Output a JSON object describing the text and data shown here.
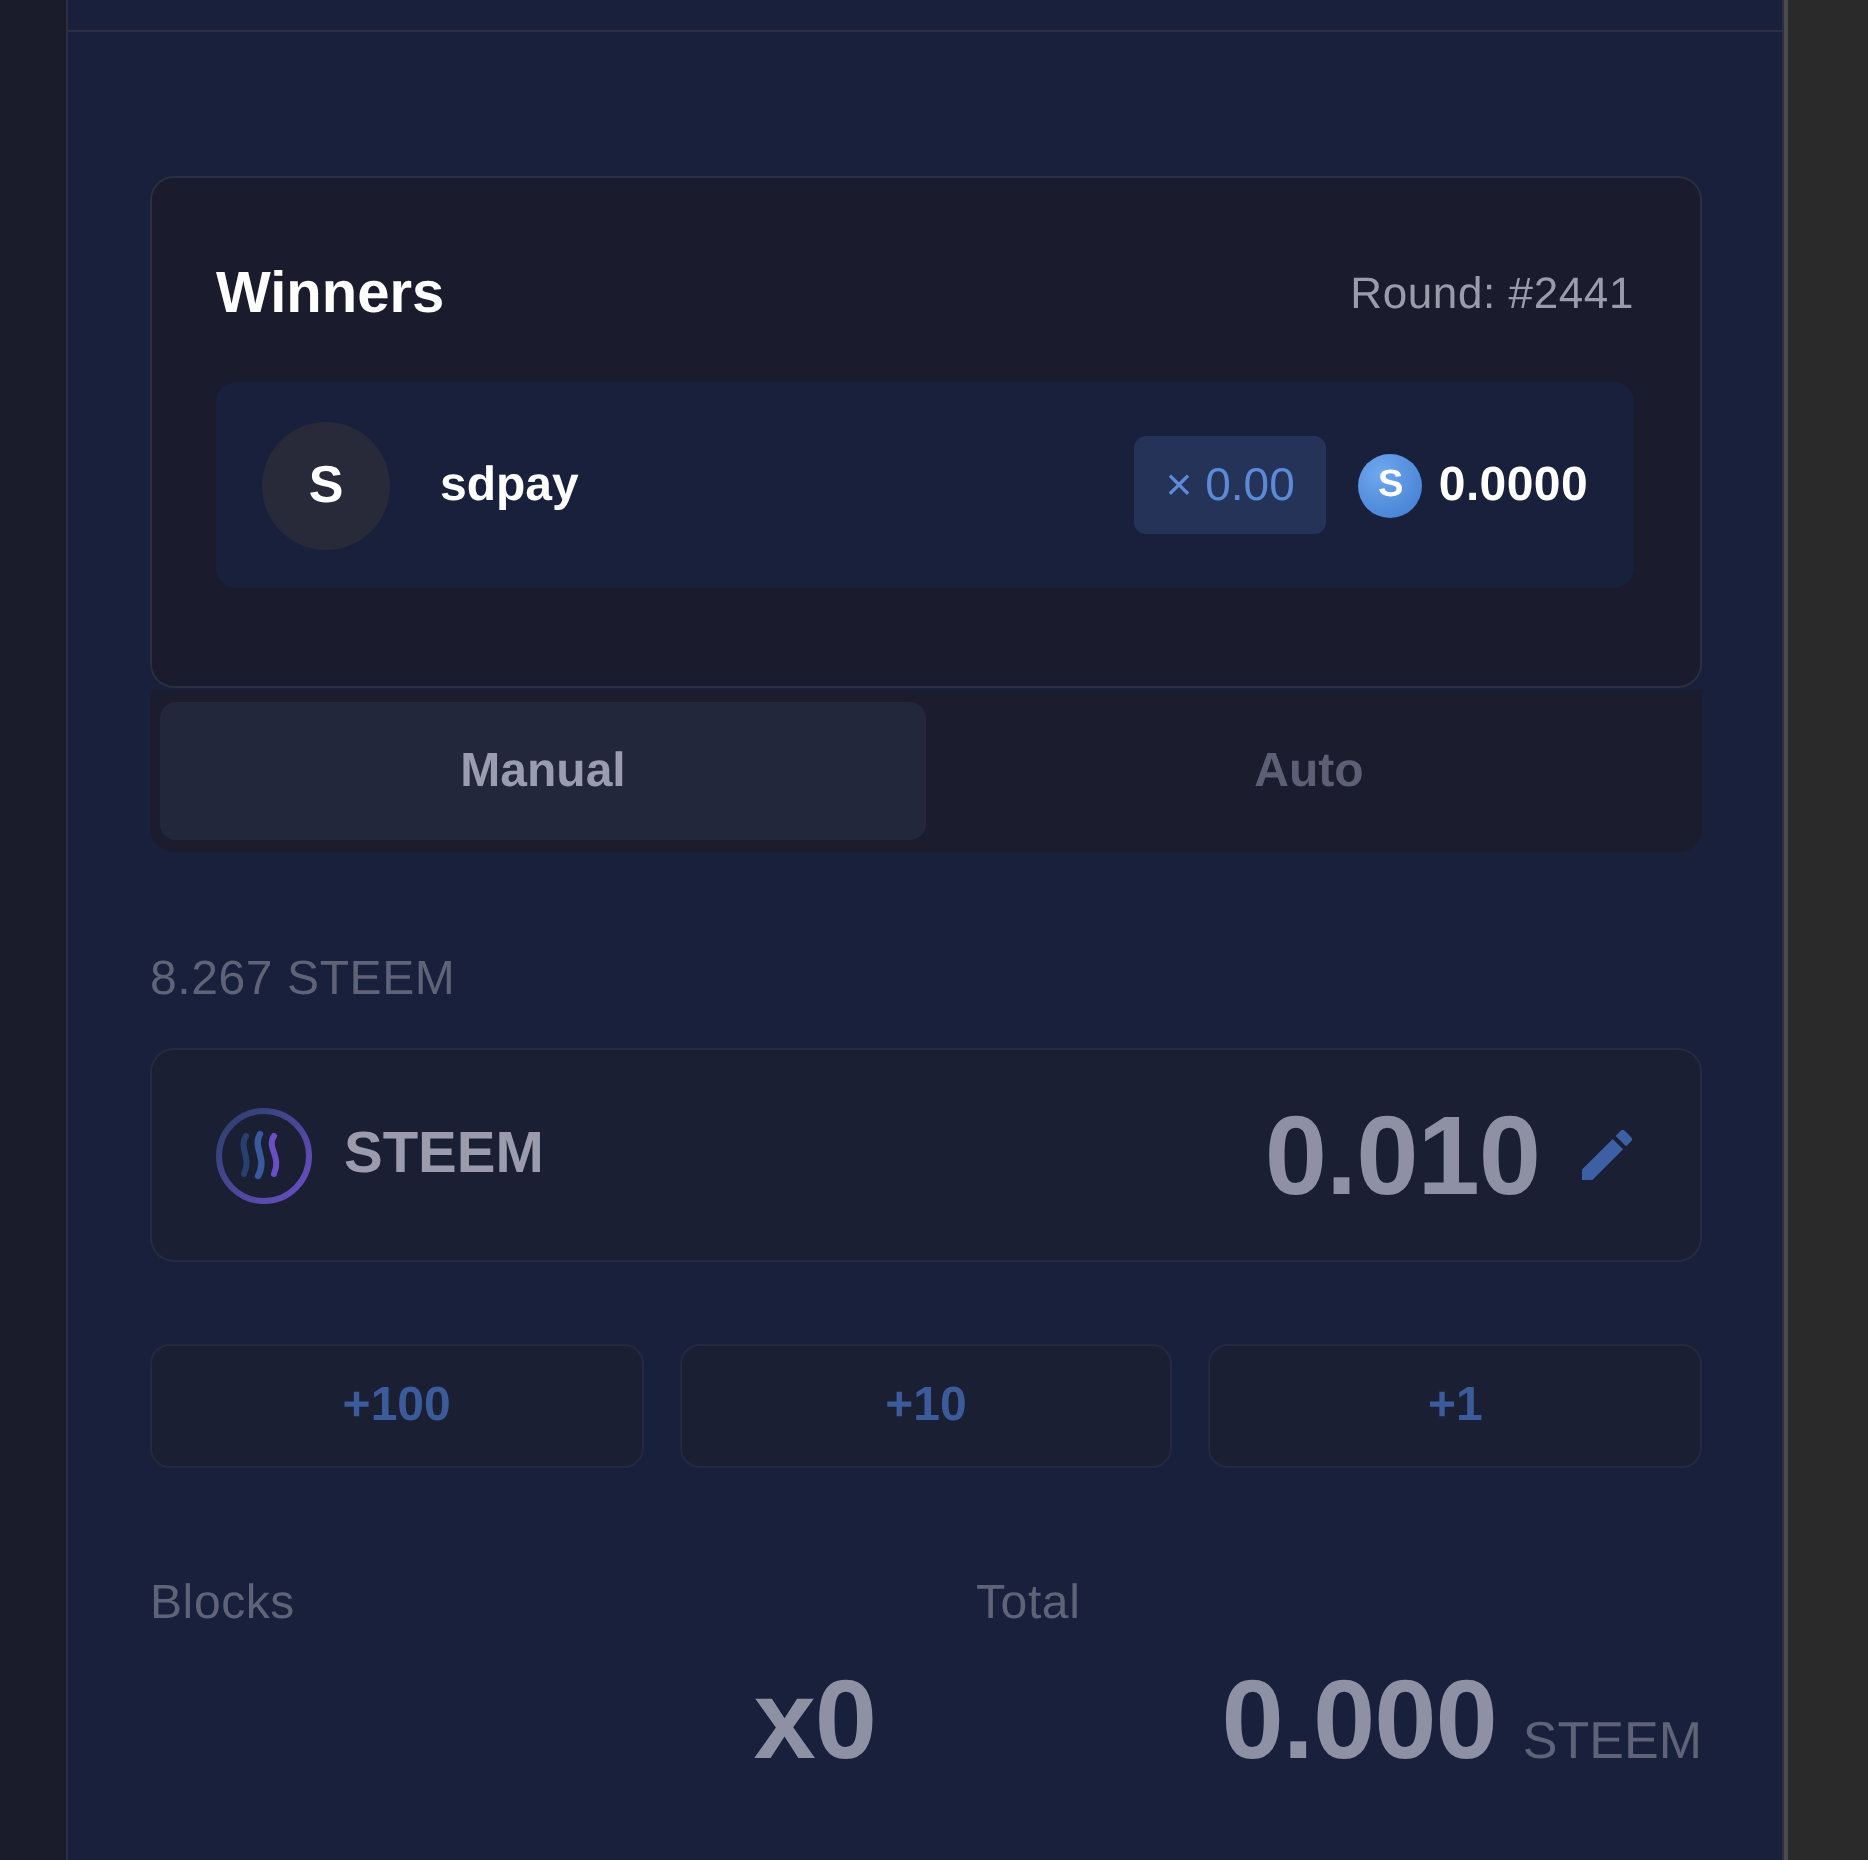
{
  "winners": {
    "title": "Winners",
    "round": "Round: #2441",
    "rows": [
      {
        "avatar": "S",
        "name": "sdpay",
        "multiplier": "× 0.00",
        "coin_symbol": "S",
        "amount": "0.0000"
      }
    ]
  },
  "mode_tabs": [
    {
      "label": "Manual",
      "selected": true
    },
    {
      "label": "Auto",
      "selected": false
    }
  ],
  "balance": "8.267 STEEM",
  "bet": {
    "currency": "STEEM",
    "value": "0.010"
  },
  "quick_add": [
    "+100",
    "+10",
    "+1"
  ],
  "summary": {
    "blocks_label": "Blocks",
    "blocks_value": "x0",
    "total_label": "Total",
    "total_value": "0.000",
    "total_unit": "STEEM"
  }
}
